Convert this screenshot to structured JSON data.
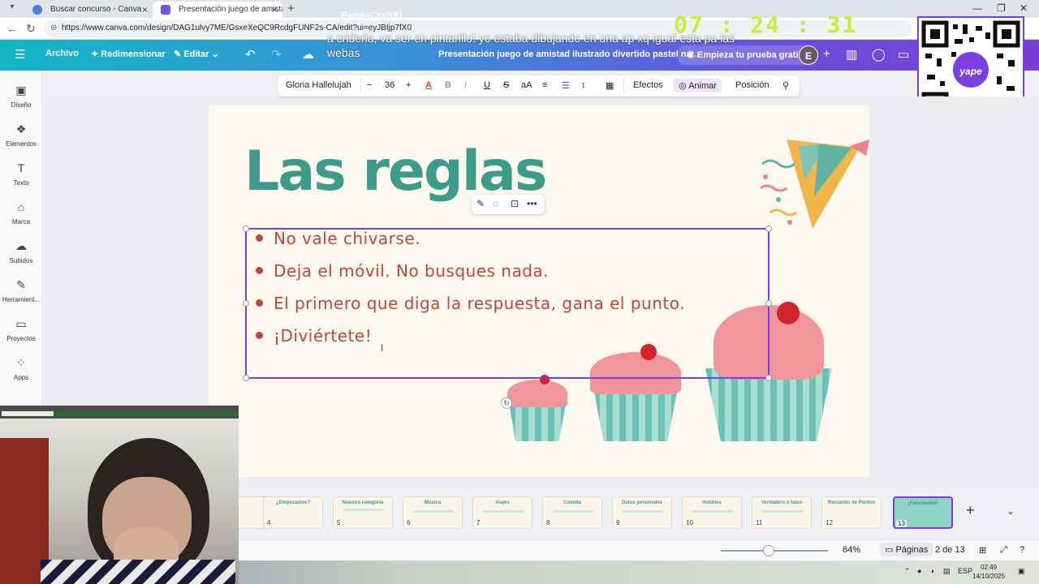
{
  "browser": {
    "tabs": [
      {
        "label": "Buscar concurso - Canva",
        "active": false
      },
      {
        "label": "Presentación juego de amistad il",
        "active": true
      }
    ],
    "url": "https://www.canva.com/design/DAG1ulvy7ME/GsxeXeQC9RcdgFUNF2s-CA/edit?ui=eyJBIjp7fX0"
  },
  "header": {
    "menu": "Archivo",
    "resize": "Redimensionar",
    "edit": "Editar",
    "doc_title": "Presentación juego de amistad ilustrado divertido pastel na...",
    "trial": "Empieza tu prueba gratis",
    "avatar_letter": "E"
  },
  "overlay": {
    "chat_text": "a criderla, va ser en pintarillo! yo estaba dibujando en una ap xq igual esta pa las webas",
    "streamer": "PandaCraft81",
    "timer": "07 : 24 : 31"
  },
  "sidebar": {
    "items": [
      {
        "label": "Diseño",
        "icon": "design-icon"
      },
      {
        "label": "Elementos",
        "icon": "elements-icon"
      },
      {
        "label": "Texto",
        "icon": "text-icon"
      },
      {
        "label": "Marca",
        "icon": "brand-icon"
      },
      {
        "label": "Subidos",
        "icon": "upload-icon"
      },
      {
        "label": "Herramient...",
        "icon": "tools-icon"
      },
      {
        "label": "Proyectos",
        "icon": "folder-icon"
      },
      {
        "label": "Apps",
        "icon": "apps-icon"
      }
    ]
  },
  "toolbar": {
    "font": "Gloria Hallelujah",
    "size": "36",
    "effects": "Efectos",
    "animate": "Animar",
    "position": "Posición"
  },
  "slide": {
    "title": "Las reglas",
    "rules": [
      "No vale chivarse.",
      "Deja el móvil. No busques nada.",
      "El primero que diga la respuesta, gana el punto.",
      "¡Diviértete!"
    ]
  },
  "thumbnails": [
    {
      "num": "4",
      "title": "¿Empezamos?"
    },
    {
      "num": "5",
      "title": "Nuestra categoría"
    },
    {
      "num": "6",
      "title": "Música"
    },
    {
      "num": "7",
      "title": "Viajes"
    },
    {
      "num": "8",
      "title": "Comida"
    },
    {
      "num": "9",
      "title": "Datos personales"
    },
    {
      "num": "10",
      "title": "Hobbies"
    },
    {
      "num": "11",
      "title": "Verdadero o falso"
    },
    {
      "num": "12",
      "title": "Recuento de Puntos"
    },
    {
      "num": "13",
      "title": "¡Felicidades!"
    }
  ],
  "status": {
    "zoom": "64%",
    "zoom_fraction": 0.45,
    "pages_label": "Páginas",
    "page_indicator": "2 de 13"
  },
  "taskbar": {
    "lang": "ESP",
    "time": "02:49",
    "date": "14/10/2025"
  },
  "webcam": {
    "progress": 0.22
  },
  "colors": {
    "title": "#3d9b8b",
    "rules": "#c24639",
    "selection": "#7d3ee0",
    "timer": "#c6ef3a"
  }
}
